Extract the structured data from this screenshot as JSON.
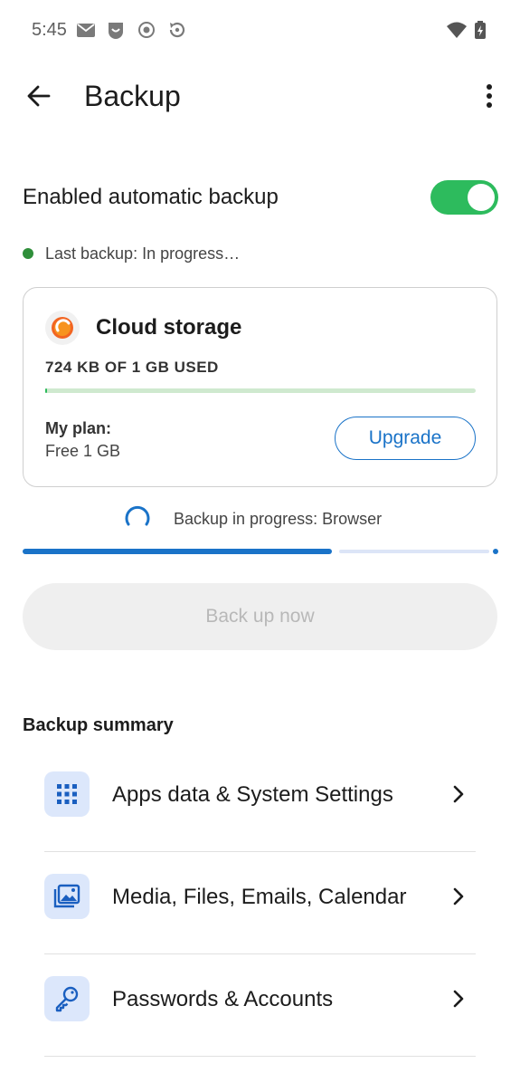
{
  "status_bar": {
    "time": "5:45",
    "icons": [
      "mail-icon",
      "app-notification-icon",
      "record-icon",
      "sync-icon",
      "wifi-icon",
      "battery-charging-icon"
    ]
  },
  "app_bar": {
    "title": "Backup",
    "back_icon": "arrow-back-icon",
    "menu_icon": "more-vert-icon"
  },
  "auto_backup": {
    "label": "Enabled automatic backup",
    "enabled": true,
    "toggle_color": "#2dbb5d"
  },
  "last_backup": {
    "text": "Last backup: In progress…",
    "status_color": "#2f8f3a"
  },
  "cloud_card": {
    "title": "Cloud storage",
    "usage_text": "724 KB OF 1 GB USED",
    "usage_fraction": 0.0007,
    "plan_label": "My plan:",
    "plan_value": "Free 1 GB",
    "upgrade_label": "Upgrade",
    "accent_color": "#1a73c8"
  },
  "backup_progress": {
    "text": "Backup in progress: Browser",
    "fraction": 0.65
  },
  "backup_now": {
    "label": "Back up now",
    "disabled": true
  },
  "summary": {
    "heading": "Backup summary",
    "items": [
      {
        "label": "Apps data & System Settings",
        "icon": "apps-grid-icon"
      },
      {
        "label": "Media, Files, Emails, Calendar",
        "icon": "photo-library-icon"
      },
      {
        "label": "Passwords & Accounts",
        "icon": "key-icon"
      }
    ]
  }
}
